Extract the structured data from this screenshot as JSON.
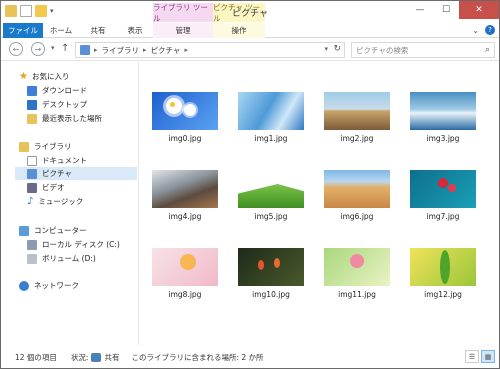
{
  "window": {
    "title": "ピクチャ",
    "controls": {
      "minimize": "—",
      "maximize": "☐",
      "close": "✕"
    }
  },
  "quick_access": {
    "dropdown": "▾"
  },
  "ribbon": {
    "contextual": [
      {
        "label": "ライブラリ ツール",
        "color": "#f7d8f3"
      },
      {
        "label": "ピクチャ ツール",
        "color": "#fbf6c3"
      }
    ],
    "tabs": [
      "ファイル",
      "ホーム",
      "共有",
      "表示",
      "管理",
      "操作"
    ],
    "expand": "⌄",
    "help": "?",
    "file_tab_color": "#1979ca"
  },
  "address": {
    "back": "←",
    "forward": "→",
    "recent": "▾",
    "up": "↑",
    "path": [
      "ライブラリ",
      "ピクチャ"
    ],
    "sep": "▸",
    "dropdown": "▾",
    "refresh": "↻"
  },
  "search": {
    "placeholder": "ピクチャの検索",
    "icon": "⌕"
  },
  "nav": {
    "favorites": "お気に入り",
    "fav_items": [
      "ダウンロード",
      "デスクトップ",
      "最近表示した場所"
    ],
    "libraries": "ライブラリ",
    "lib_items": [
      "ドキュメント",
      "ピクチャ",
      "ビデオ",
      "ミュージック"
    ],
    "computer": "コンピューター",
    "comp_items": [
      "ローカル ディスク (C:)",
      "ボリューム (D:)"
    ],
    "network": "ネットワーク"
  },
  "files": [
    {
      "name": "img0.jpg"
    },
    {
      "name": "img1.jpg"
    },
    {
      "name": "img2.jpg"
    },
    {
      "name": "img3.jpg"
    },
    {
      "name": "img4.jpg"
    },
    {
      "name": "img5.jpg"
    },
    {
      "name": "img6.jpg"
    },
    {
      "name": "img7.jpg"
    },
    {
      "name": "img8.jpg"
    },
    {
      "name": "img10.jpg"
    },
    {
      "name": "img11.jpg"
    },
    {
      "name": "img12.jpg"
    }
  ],
  "status": {
    "count": "12 個の項目",
    "state_label": "状況:",
    "state_value": "共有",
    "note": "このライブラリに含まれる場所: 2 か所"
  }
}
